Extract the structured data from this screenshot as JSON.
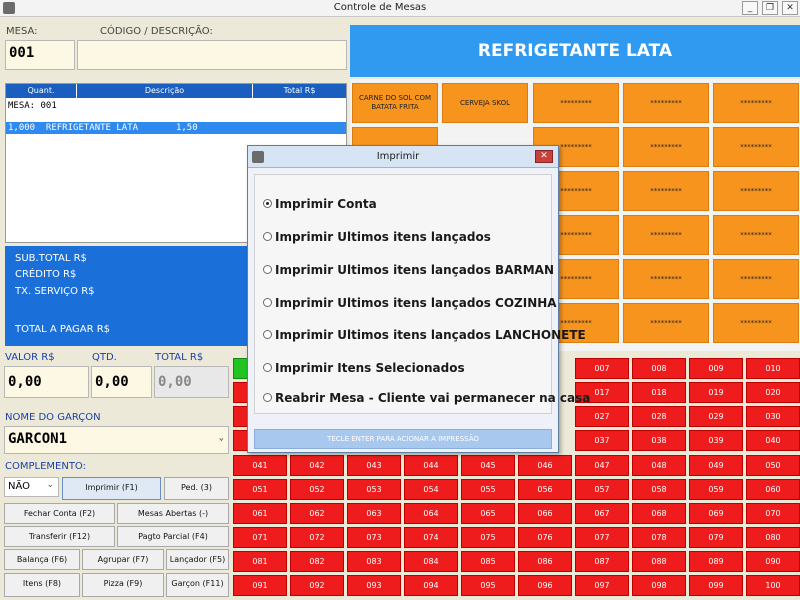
{
  "window": {
    "title": "Controle de Mesas",
    "minimize": "_",
    "restore": "❐",
    "close": "✕"
  },
  "labels": {
    "mesa": "MESA:",
    "codigo": "CÓDIGO / DESCRIÇÃO:",
    "valor": "VALOR R$",
    "qtd": "QTD.",
    "total": "TOTAL R$",
    "garcom": "NOME DO GARÇON",
    "complemento": "COMPLEMENTO:"
  },
  "fields": {
    "mesa": "001",
    "codigo": "",
    "valor": "0,00",
    "qtd": "0,00",
    "total": "0,00",
    "garcom": "GARCON1",
    "complemento": "NÃO"
  },
  "product_banner": "REFRIGETANTE LATA",
  "list": {
    "headers": [
      "Quant.",
      "Descrição",
      "Total R$"
    ],
    "line1": "MESA: 001",
    "line2": "1,000  REFRIGETANTE LATA       1,50"
  },
  "totals": {
    "sub": "SUB.TOTAL R$",
    "credito": "CRÉDITO R$",
    "servico": "TX. SERVIÇO R$",
    "pagar": "TOTAL A PAGAR R$"
  },
  "products": [
    "CARNE DO SOL COM BATATA FRITA",
    "CERVEJA SKOL",
    "*********",
    "*********",
    "*********"
  ],
  "product_placeholder": "*********",
  "buttons": {
    "imprimir": "Imprimir (F1)",
    "ped": "Ped. (3)",
    "fechar": "Fechar Conta (F2)",
    "abertas": "Mesas Abertas (-)",
    "transferir": "Transferir (F12)",
    "pagto": "Pagto Parcial (F4)",
    "balanca": "Balança (F6)",
    "agrupar": "Agrupar (F7)",
    "lancador": "Lançador (F5)",
    "itens": "Itens (F8)",
    "pizza": "Pizza (F9)",
    "garcon": "Garçon (F11)"
  },
  "tables": {
    "row_top": [
      "007",
      "008",
      "009",
      "010"
    ],
    "row_2": [
      "017",
      "018",
      "019",
      "020"
    ],
    "row_3": [
      "027",
      "028",
      "029",
      "030"
    ],
    "row_4": [
      "037",
      "038",
      "039",
      "040"
    ],
    "rows_full": [
      [
        "041",
        "042",
        "043",
        "044",
        "045",
        "046",
        "047",
        "048",
        "049",
        "050"
      ],
      [
        "051",
        "052",
        "053",
        "054",
        "055",
        "056",
        "057",
        "058",
        "059",
        "060"
      ],
      [
        "061",
        "062",
        "063",
        "064",
        "065",
        "066",
        "067",
        "068",
        "069",
        "070"
      ],
      [
        "071",
        "072",
        "073",
        "074",
        "075",
        "076",
        "077",
        "078",
        "079",
        "080"
      ],
      [
        "081",
        "082",
        "083",
        "084",
        "085",
        "086",
        "087",
        "088",
        "089",
        "090"
      ],
      [
        "091",
        "092",
        "093",
        "094",
        "095",
        "096",
        "097",
        "098",
        "099",
        "100"
      ]
    ]
  },
  "dialog": {
    "title": "Imprimir",
    "close": "✕",
    "options": [
      "Imprimir Conta",
      "Imprimir Ultimos itens lançados",
      "Imprimir Ultimos itens lançados BARMAN",
      "Imprimir Ultimos itens lançados COZINHA",
      "Imprimir Ultimos itens lançados LANCHONETE",
      "Imprimir Itens Selecionados",
      "Reabrir Mesa - Cliente vai permanecer na casa"
    ],
    "selected_index": 0,
    "hint": "TECLE ENTER PARA ACIONAR A IMPRESSÃO"
  }
}
